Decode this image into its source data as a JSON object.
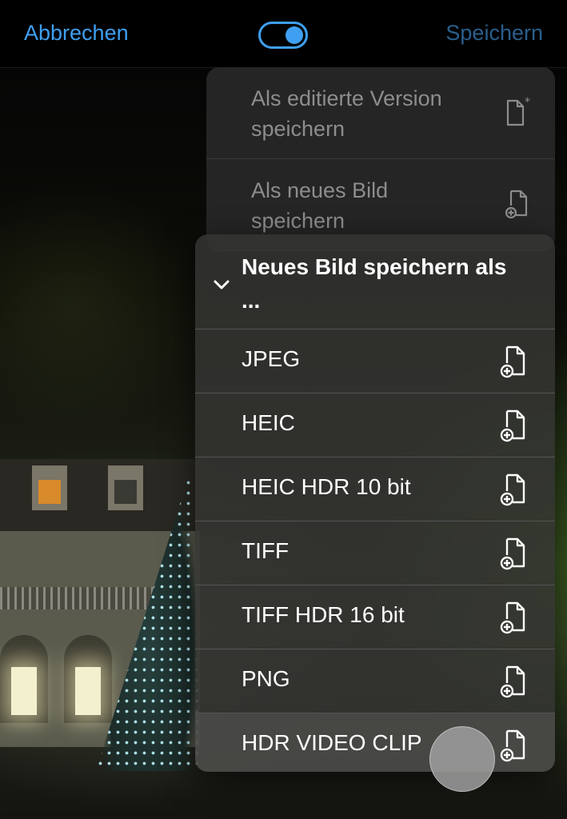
{
  "topbar": {
    "cancel_label": "Abbrechen",
    "save_label": "Speichern",
    "toggle_state": "on",
    "accent_color": "#3f9ff0"
  },
  "back_menu": {
    "items": [
      {
        "label": "Als editierte Version speichern",
        "icon": "document-edited-icon"
      },
      {
        "label": "Als neues Bild speichern",
        "icon": "document-add-icon"
      }
    ]
  },
  "submenu": {
    "title": "Neues Bild speichern als ...",
    "expanded": true,
    "items": [
      {
        "label": "JPEG",
        "icon": "document-add-icon"
      },
      {
        "label": "HEIC",
        "icon": "document-add-icon"
      },
      {
        "label": "HEIC HDR 10 bit",
        "icon": "document-add-icon"
      },
      {
        "label": "TIFF",
        "icon": "document-add-icon"
      },
      {
        "label": "TIFF HDR 16 bit",
        "icon": "document-add-icon"
      },
      {
        "label": "PNG",
        "icon": "document-add-icon"
      },
      {
        "label": "HDR VIDEO CLIP",
        "icon": "document-add-icon",
        "highlighted": true
      }
    ]
  }
}
